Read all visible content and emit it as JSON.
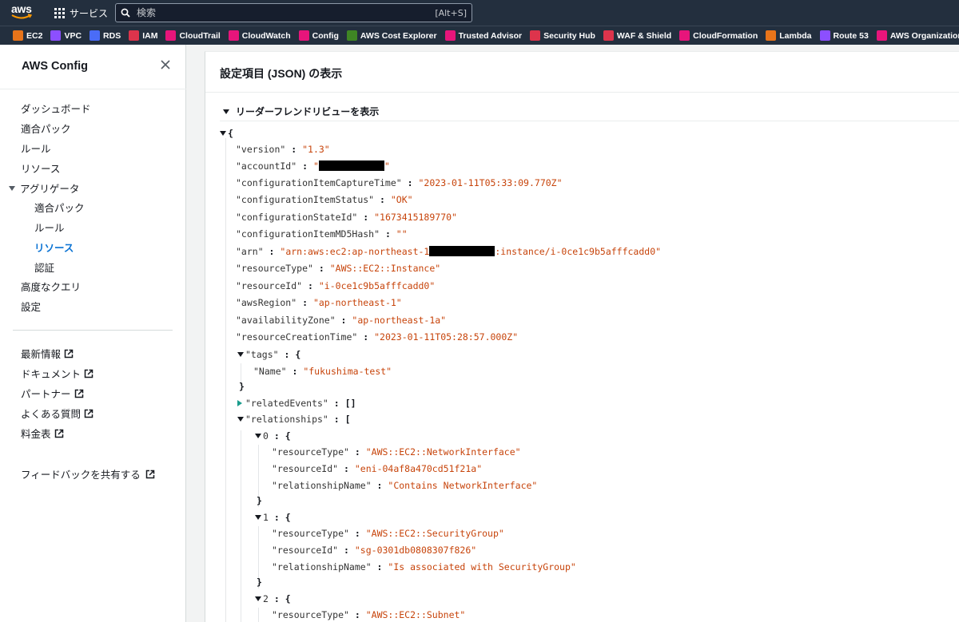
{
  "topnav": {
    "logo_text": "aws",
    "services_label": "サービス",
    "search_placeholder": "検索",
    "search_shortcut": "[Alt+S]"
  },
  "favorites": [
    {
      "label": "EC2",
      "color": "#e8741a"
    },
    {
      "label": "VPC",
      "color": "#8c4fff"
    },
    {
      "label": "RDS",
      "color": "#4a6cf7"
    },
    {
      "label": "IAM",
      "color": "#dd344c"
    },
    {
      "label": "CloudTrail",
      "color": "#e7157b"
    },
    {
      "label": "CloudWatch",
      "color": "#e7157b"
    },
    {
      "label": "Config",
      "color": "#e7157b"
    },
    {
      "label": "AWS Cost Explorer",
      "color": "#3f8624"
    },
    {
      "label": "Trusted Advisor",
      "color": "#e7157b"
    },
    {
      "label": "Security Hub",
      "color": "#dd344c"
    },
    {
      "label": "WAF & Shield",
      "color": "#dd344c"
    },
    {
      "label": "CloudFormation",
      "color": "#e7157b"
    },
    {
      "label": "Lambda",
      "color": "#e8741a"
    },
    {
      "label": "Route 53",
      "color": "#8c4fff"
    },
    {
      "label": "AWS Organizations",
      "color": "#e7157b"
    }
  ],
  "sidebar": {
    "title": "AWS Config",
    "items": [
      {
        "label": "ダッシュボード"
      },
      {
        "label": "適合パック"
      },
      {
        "label": "ルール"
      },
      {
        "label": "リソース"
      },
      {
        "label": "アグリゲータ"
      },
      {
        "label": "適合パック"
      },
      {
        "label": "ルール"
      },
      {
        "label": "リソース"
      },
      {
        "label": "認証"
      },
      {
        "label": "高度なクエリ"
      },
      {
        "label": "設定"
      }
    ],
    "links": [
      {
        "label": "最新情報"
      },
      {
        "label": "ドキュメント"
      },
      {
        "label": "パートナー"
      },
      {
        "label": "よくある質問"
      },
      {
        "label": "料金表"
      }
    ],
    "feedback": "フィードバックを共有する"
  },
  "main": {
    "title": "設定項目 (JSON) の表示",
    "friendly_toggle": "リーダーフレンドリビューを表示"
  },
  "json": {
    "open_brace": "{",
    "close_brace": "}",
    "open_bracket": "[",
    "empty_array": "[]",
    "colon": " : ",
    "fields": {
      "version": {
        "key": "\"version\"",
        "value": "\"1.3\""
      },
      "accountId": {
        "key": "\"accountId\"",
        "value_prefix": "\"",
        "value_suffix": "\""
      },
      "captureTime": {
        "key": "\"configurationItemCaptureTime\"",
        "value": "\"2023-01-11T05:33:09.770Z\""
      },
      "status": {
        "key": "\"configurationItemStatus\"",
        "value": "\"OK\""
      },
      "stateId": {
        "key": "\"configurationStateId\"",
        "value": "\"1673415189770\""
      },
      "md5": {
        "key": "\"configurationItemMD5Hash\"",
        "value": "\"\""
      },
      "arn": {
        "key": "\"arn\"",
        "value_prefix": "\"arn:aws:ec2:ap-northeast-1",
        "value_suffix": ":instance/i-0ce1c9b5afffcadd0\""
      },
      "resourceType": {
        "key": "\"resourceType\"",
        "value": "\"AWS::EC2::Instance\""
      },
      "resourceId": {
        "key": "\"resourceId\"",
        "value": "\"i-0ce1c9b5afffcadd0\""
      },
      "awsRegion": {
        "key": "\"awsRegion\"",
        "value": "\"ap-northeast-1\""
      },
      "az": {
        "key": "\"availabilityZone\"",
        "value": "\"ap-northeast-1a\""
      },
      "creationTime": {
        "key": "\"resourceCreationTime\"",
        "value": "\"2023-01-11T05:28:57.000Z\""
      },
      "tags": {
        "key": "\"tags\""
      },
      "tagName": {
        "key": "\"Name\"",
        "value": "\"fukushima-test\""
      },
      "relatedEvents": {
        "key": "\"relatedEvents\""
      },
      "relationships": {
        "key": "\"relationships\""
      }
    },
    "relationships": [
      {
        "index": "0",
        "resourceType": "\"AWS::EC2::NetworkInterface\"",
        "resourceId": "\"eni-04af8a470cd51f21a\"",
        "relationshipName": "\"Contains NetworkInterface\""
      },
      {
        "index": "1",
        "resourceType": "\"AWS::EC2::SecurityGroup\"",
        "resourceId": "\"sg-0301db0808307f826\"",
        "relationshipName": "\"Is associated with SecurityGroup\""
      },
      {
        "index": "2",
        "resourceType": "\"AWS::EC2::Subnet\""
      }
    ],
    "rel_keys": {
      "resourceType": "\"resourceType\"",
      "resourceId": "\"resourceId\"",
      "relationshipName": "\"relationshipName\""
    }
  }
}
